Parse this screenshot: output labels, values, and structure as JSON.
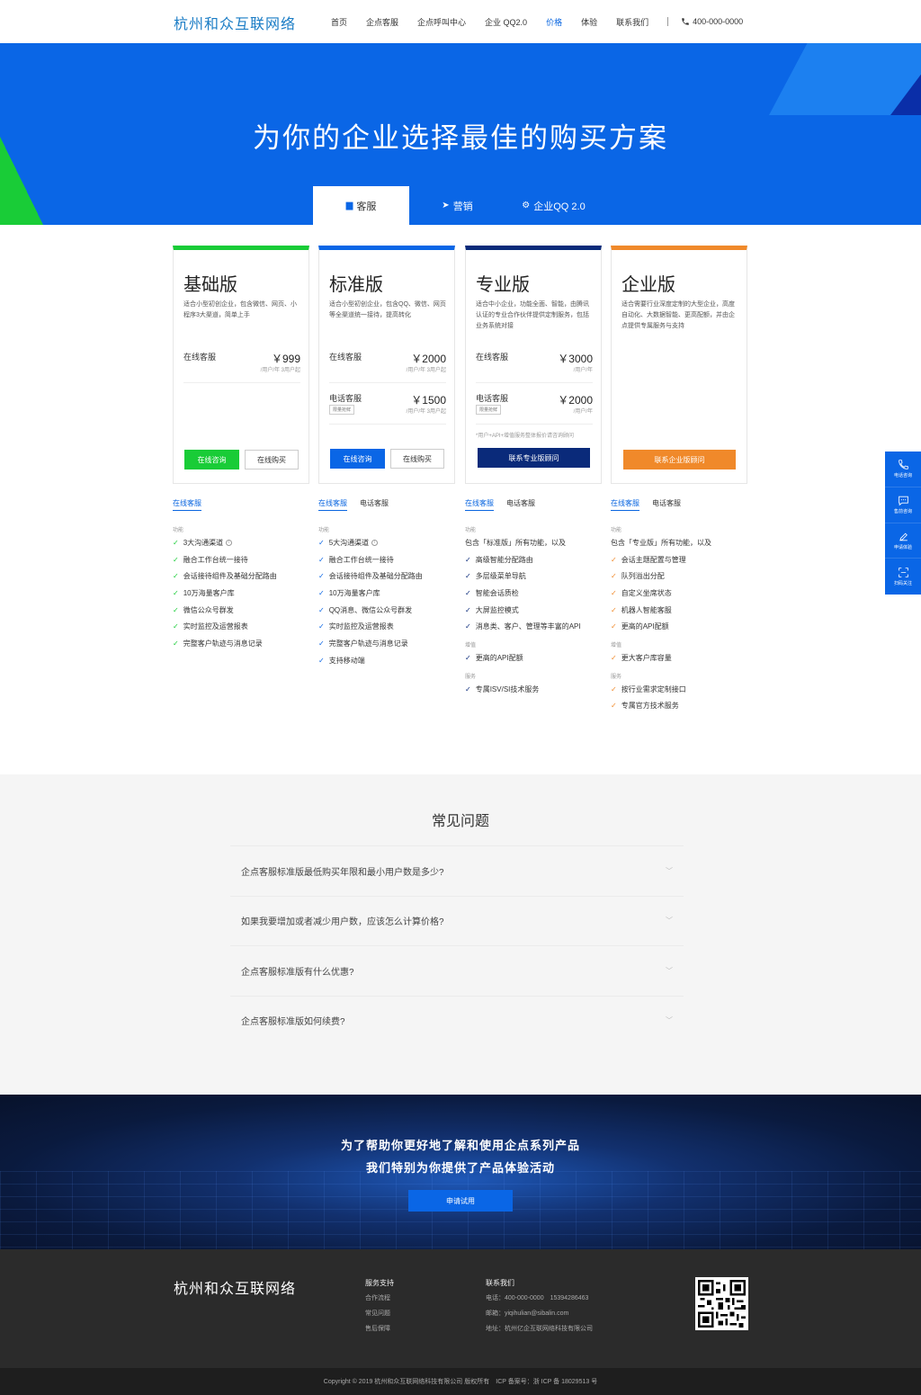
{
  "header": {
    "logo": "杭州和众互联网络",
    "nav": [
      "首页",
      "企点客服",
      "企点呼叫中心",
      "企业 QQ2.0",
      "价格",
      "体验",
      "联系我们"
    ],
    "active_nav": "价格",
    "phone": "400-000-0000"
  },
  "hero": {
    "title": "为你的企业选择最佳的购买方案",
    "tabs": [
      "客服",
      "营销",
      "企业QQ 2.0"
    ],
    "active_tab": "客服"
  },
  "colors": {
    "primary": "#0a66e6",
    "green": "#19cc37",
    "navy": "#0a2a7a",
    "orange": "#f0892a"
  },
  "plans": [
    {
      "name": "基础版",
      "desc": "适合小型初创企业，包含微信、网页、小程序3大渠道，简单上手",
      "prices": [
        {
          "label": "在线客服",
          "value": "￥999",
          "unit": "/用户/年 3用户起"
        }
      ],
      "buttons": [
        "在线咨询",
        "在线购买"
      ]
    },
    {
      "name": "标准版",
      "desc": "适合小型初创企业，包含QQ、微信、网页等全渠道统一接待，提高转化",
      "prices": [
        {
          "label": "在线客服",
          "value": "￥2000",
          "unit": "/用户/年 3用户起"
        },
        {
          "label": "电话客服",
          "badge": "限量抢鲜",
          "value": "￥1500",
          "unit": "/用户/年 3用户起"
        }
      ],
      "buttons": [
        "在线咨询",
        "在线购买"
      ]
    },
    {
      "name": "专业版",
      "desc": "适合中小企业，功能全面、智能，由腾讯认证的专业合作伙伴提供定制服务，包括业务系统对接",
      "prices": [
        {
          "label": "在线客服",
          "value": "￥3000",
          "unit": "/用户/年"
        },
        {
          "label": "电话客服",
          "badge": "限量抢鲜",
          "value": "￥2000",
          "unit": "/用户/年"
        }
      ],
      "note": "*用户+API+增值服务整体报价请咨询顾问",
      "buttons": [
        "联系专业版顾问"
      ]
    },
    {
      "name": "企业版",
      "desc": "适合需要行业深度定制的大型企业，高度自动化、大数据智能、更高配额，并由企点提供专属服务与支持",
      "prices": [],
      "buttons": [
        "联系企业版顾问"
      ]
    }
  ],
  "features": [
    {
      "tabs": [
        "在线客服"
      ],
      "groups": [
        {
          "title": "功能",
          "items": [
            "3大沟通渠道",
            "融合工作台统一接待",
            "会话接待组件及基础分配路由",
            "10万海量客户库",
            "微信公众号群发",
            "实时监控及运营报表",
            "完整客户轨迹与消息记录"
          ]
        }
      ]
    },
    {
      "tabs": [
        "在线客服",
        "电话客服"
      ],
      "groups": [
        {
          "title": "功能",
          "items": [
            "5大沟通渠道",
            "融合工作台统一接待",
            "会话接待组件及基础分配路由",
            "10万海量客户库",
            "QQ消息、微信公众号群发",
            "实时监控及运营报表",
            "完整客户轨迹与消息记录",
            "支持移动端"
          ]
        }
      ]
    },
    {
      "tabs": [
        "在线客服",
        "电话客服"
      ],
      "lead": "包含「标准版」所有功能，以及",
      "groups": [
        {
          "title": "功能",
          "items": [
            "高级智能分配路由",
            "多层级菜单导航",
            "智能会话质检",
            "大屏监控模式",
            "消息类、客户、管理等丰富的API"
          ]
        },
        {
          "title": "增值",
          "items": [
            "更高的API配额"
          ]
        },
        {
          "title": "服务",
          "items": [
            "专属ISV/SI技术服务"
          ]
        }
      ]
    },
    {
      "tabs": [
        "在线客服",
        "电话客服"
      ],
      "lead": "包含「专业版」所有功能，以及",
      "groups": [
        {
          "title": "功能",
          "items": [
            "会话主题配置与管理",
            "队列溢出分配",
            "自定义坐席状态",
            "机器人智能客服",
            "更高的API配额"
          ]
        },
        {
          "title": "增值",
          "items": [
            "更大客户库容量"
          ]
        },
        {
          "title": "服务",
          "items": [
            "按行业需求定制接口",
            "专属官方技术服务"
          ]
        }
      ]
    }
  ],
  "faq": {
    "title": "常见问题",
    "items": [
      "企点客服标准版最低购买年限和最小用户数是多少?",
      "如果我要增加或者减少用户数，应该怎么计算价格?",
      "企点客服标准版有什么优惠?",
      "企点客服标准版如何续费?"
    ]
  },
  "cta": {
    "line1": "为了帮助你更好地了解和使用企点系列产品",
    "line2": "我们特别为你提供了产品体验活动",
    "button": "申请试用"
  },
  "footer": {
    "logo": "杭州和众互联网络",
    "service_title": "服务支持",
    "service_links": [
      "合作流程",
      "常见问题",
      "售后保障"
    ],
    "contact_title": "联系我们",
    "phone": "电话：400-000-0000　15394286463",
    "email": "邮箱：yiqihulian@sibalin.com",
    "address": "地址：杭州亿企互联网络科技有限公司",
    "copyright": "Copyright © 2019 杭州和众互联网络科技有限公司 版权所有　ICP 备案号：浙 ICP 备 18029513 号"
  },
  "sidebar": [
    "电话咨询",
    "售前咨询",
    "申请体验",
    "扫码关注"
  ]
}
